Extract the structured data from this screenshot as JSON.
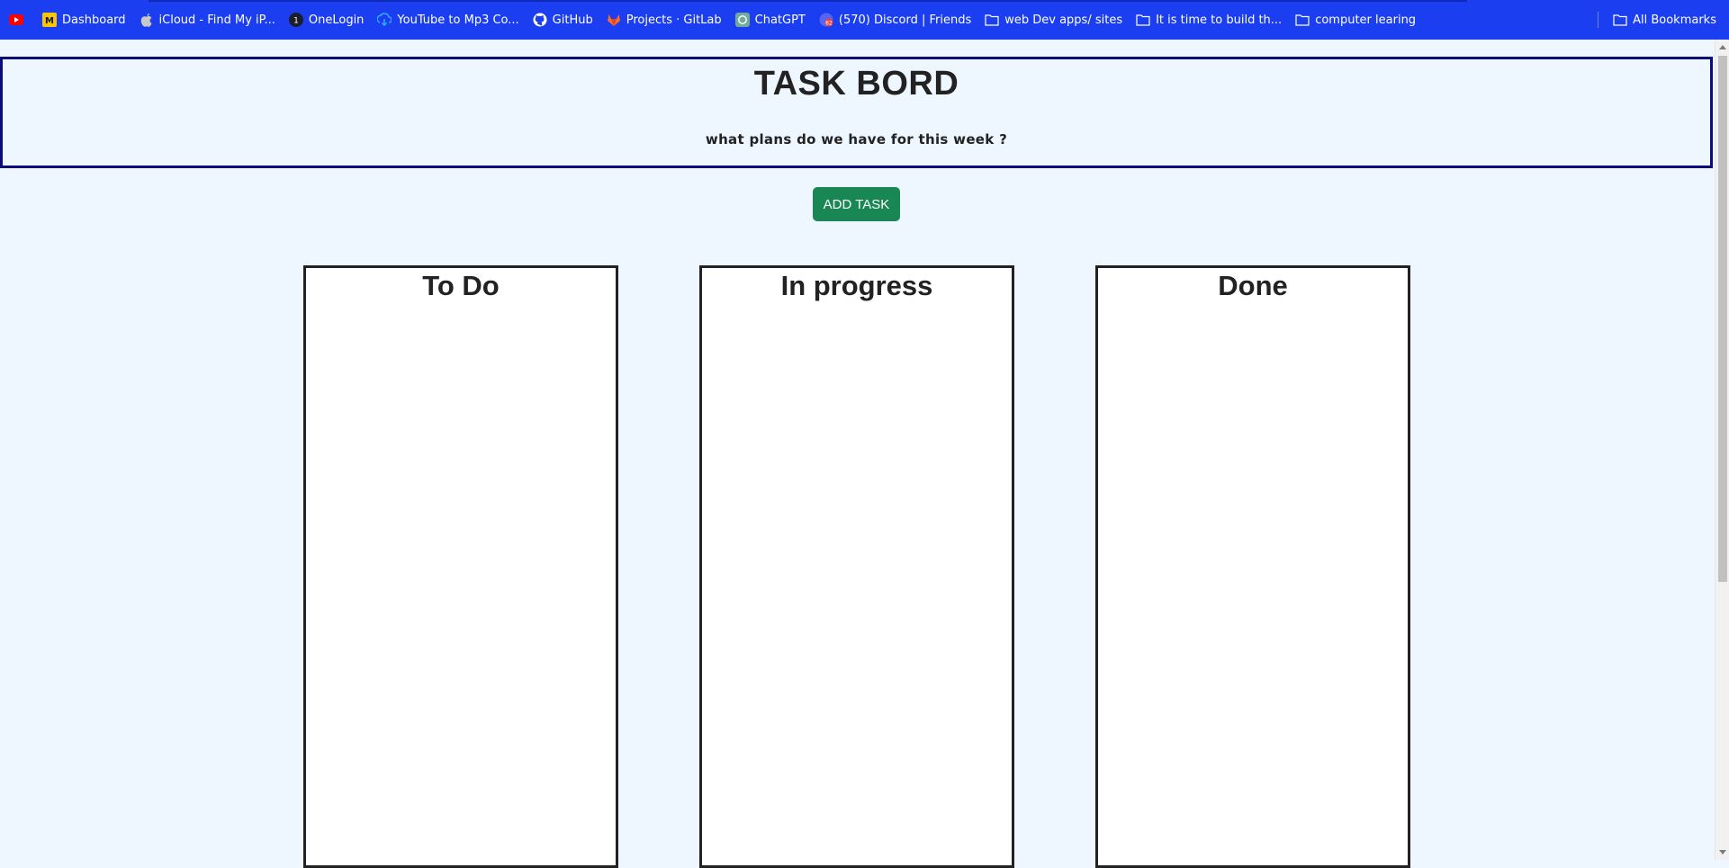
{
  "bookmarks": [
    {
      "label": "",
      "icon": "youtube-icon"
    },
    {
      "label": "Dashboard",
      "icon": "dashboard-icon"
    },
    {
      "label": "iCloud - Find My iP...",
      "icon": "apple-icon"
    },
    {
      "label": "OneLogin",
      "icon": "onelogin-icon"
    },
    {
      "label": "YouTube to Mp3 Co...",
      "icon": "download-icon"
    },
    {
      "label": "GitHub",
      "icon": "github-icon"
    },
    {
      "label": "Projects · GitLab",
      "icon": "gitlab-icon"
    },
    {
      "label": "ChatGPT",
      "icon": "chatgpt-icon"
    },
    {
      "label": "(570) Discord | Friends",
      "icon": "discord-icon"
    },
    {
      "label": "web Dev apps/ sites",
      "icon": "folder-icon"
    },
    {
      "label": "It is time to build th...",
      "icon": "folder-icon"
    },
    {
      "label": "computer learing",
      "icon": "folder-icon"
    }
  ],
  "all_bookmarks_label": "All Bookmarks",
  "header": {
    "title": "TASK BORD",
    "subtitle": "what plans do we have for this week ?"
  },
  "add_task_label": "ADD TASK",
  "columns": {
    "todo": "To Do",
    "in_progress": "In progress",
    "done": "Done"
  },
  "colors": {
    "bookmarks_bar": "#1a3ef0",
    "page_background": "#eef6ff",
    "header_border": "#0b0c7a",
    "add_button": "#198754"
  }
}
